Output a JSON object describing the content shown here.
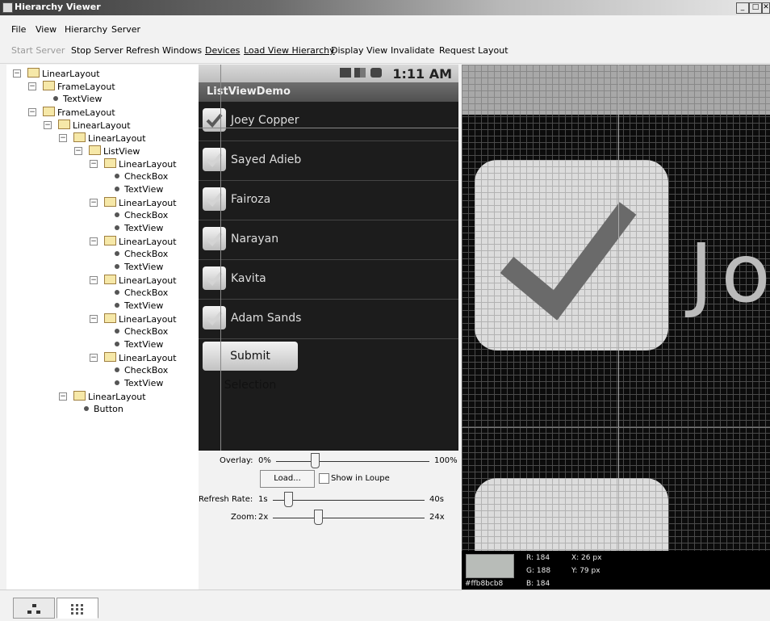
{
  "window": {
    "title": "Hierarchy Viewer",
    "min": "_",
    "max": "□",
    "close": "✕"
  },
  "menu": [
    "File",
    "View",
    "Hierarchy",
    "Server"
  ],
  "toolbar": {
    "start_server": "Start Server",
    "stop_server": "Stop Server",
    "refresh_windows": "Refresh Windows",
    "devices": "Devices",
    "load_view_hierarchy": "Load View Hierarchy",
    "display_view": "Display View",
    "invalidate": "Invalidate",
    "request_layout": "Request Layout"
  },
  "tree": [
    {
      "label": "LinearLayout",
      "type": "folder",
      "level": 0
    },
    {
      "label": "FrameLayout",
      "type": "folder",
      "level": 1
    },
    {
      "label": "TextView",
      "type": "leaf",
      "level": 2
    },
    {
      "label": "FrameLayout",
      "type": "folder",
      "level": 1
    },
    {
      "label": "LinearLayout",
      "type": "folder",
      "level": 2
    },
    {
      "label": "LinearLayout",
      "type": "folder",
      "level": 3
    },
    {
      "label": "ListView",
      "type": "folder",
      "level": 4
    },
    {
      "label": "LinearLayout",
      "type": "folder",
      "level": 5
    },
    {
      "label": "CheckBox",
      "type": "leaf",
      "level": 6
    },
    {
      "label": "TextView",
      "type": "leaf",
      "level": 6
    },
    {
      "label": "LinearLayout",
      "type": "folder",
      "level": 5
    },
    {
      "label": "CheckBox",
      "type": "leaf",
      "level": 6
    },
    {
      "label": "TextView",
      "type": "leaf",
      "level": 6
    },
    {
      "label": "LinearLayout",
      "type": "folder",
      "level": 5
    },
    {
      "label": "CheckBox",
      "type": "leaf",
      "level": 6
    },
    {
      "label": "TextView",
      "type": "leaf",
      "level": 6
    },
    {
      "label": "LinearLayout",
      "type": "folder",
      "level": 5
    },
    {
      "label": "CheckBox",
      "type": "leaf",
      "level": 6
    },
    {
      "label": "TextView",
      "type": "leaf",
      "level": 6
    },
    {
      "label": "LinearLayout",
      "type": "folder",
      "level": 5
    },
    {
      "label": "CheckBox",
      "type": "leaf",
      "level": 6
    },
    {
      "label": "TextView",
      "type": "leaf",
      "level": 6
    },
    {
      "label": "LinearLayout",
      "type": "folder",
      "level": 5
    },
    {
      "label": "CheckBox",
      "type": "leaf",
      "level": 6
    },
    {
      "label": "TextView",
      "type": "leaf",
      "level": 6
    },
    {
      "label": "LinearLayout",
      "type": "folder",
      "level": 3
    },
    {
      "label": "Button",
      "type": "leaf",
      "level": 4
    }
  ],
  "phone": {
    "time": "1:11 AM",
    "app_title": "ListViewDemo",
    "items": [
      "Joey Copper",
      "Sayed Adieb",
      "Fairoza",
      "Narayan",
      "Kavita",
      "Adam Sands"
    ],
    "submit": "Submit Selection"
  },
  "controls": {
    "overlay_label": "Overlay:",
    "overlay_min": "0%",
    "overlay_max": "100%",
    "overlay_value": 0.25,
    "load": "Load...",
    "show_in_loupe": "Show in Loupe",
    "refresh_label": "Refresh Rate:",
    "refresh_min": "1s",
    "refresh_max": "40s",
    "refresh_value": 0.1,
    "zoom_label": "Zoom:",
    "zoom_min": "2x",
    "zoom_max": "24x",
    "zoom_value": 0.3
  },
  "loupe": {
    "text": "Jo"
  },
  "pixel": {
    "hex": "#ffb8bcb8",
    "r": "R:  184",
    "g": "G:  188",
    "b": "B:  184",
    "x": "X:  26 px",
    "y": "Y:  79 px",
    "swatch_color": "#b8bcb8"
  },
  "bottom_tabs": [
    "tree-view",
    "pixel-perfect"
  ]
}
